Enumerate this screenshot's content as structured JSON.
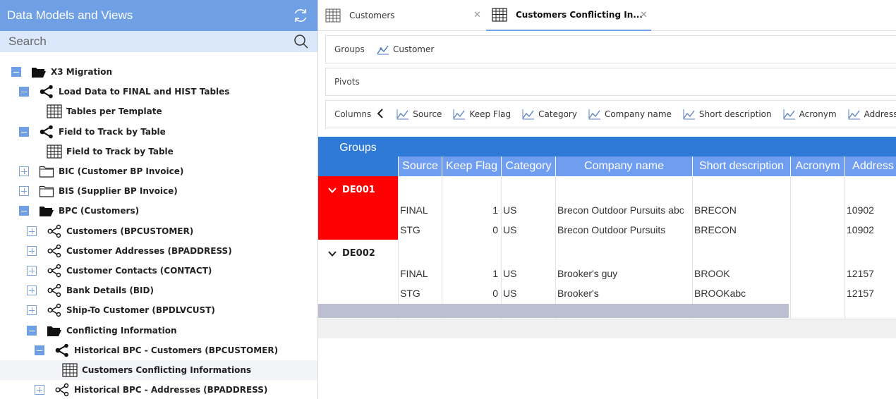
{
  "left_panel": {
    "title": "Data Models and Views",
    "search_placeholder": "Search",
    "tree": [
      {
        "label": "X3 Migration",
        "level": 0,
        "expander": "minus",
        "icon": "folder-open-icon"
      },
      {
        "label": "Load Data to FINAL and HIST Tables",
        "level": 1,
        "expander": "minus",
        "icon": "model-graph-icon"
      },
      {
        "label": "Tables per Template",
        "level": 2,
        "expander": "none",
        "icon": "table-grid-icon"
      },
      {
        "label": "Field to Track by Table",
        "level": 1,
        "expander": "minus",
        "icon": "model-graph-icon"
      },
      {
        "label": "Field to Track by Table",
        "level": 2,
        "expander": "none",
        "icon": "table-grid-icon"
      },
      {
        "label": "BIC (Customer BP Invoice)",
        "level": 1,
        "expander": "plus",
        "icon": "folder-closed-icon"
      },
      {
        "label": "BIS (Supplier BP Invoice)",
        "level": 1,
        "expander": "plus",
        "icon": "folder-closed-icon"
      },
      {
        "label": "BPC (Customers)",
        "level": 1,
        "expander": "minus",
        "icon": "folder-open-icon"
      },
      {
        "label": "Customers (BPCUSTOMER)",
        "level": 2,
        "expander": "plus",
        "icon": "model-graph-outline-icon"
      },
      {
        "label": "Customer Addresses (BPADDRESS)",
        "level": 2,
        "expander": "plus",
        "icon": "model-graph-outline-icon"
      },
      {
        "label": "Customer Contacts (CONTACT)",
        "level": 2,
        "expander": "plus",
        "icon": "model-graph-outline-icon"
      },
      {
        "label": "Bank Details (BID)",
        "level": 2,
        "expander": "plus",
        "icon": "model-graph-outline-icon"
      },
      {
        "label": "Ship-To Customer (BPDLVCUST)",
        "level": 2,
        "expander": "plus",
        "icon": "model-graph-outline-icon"
      },
      {
        "label": "Conflicting Information",
        "level": 2,
        "expander": "minus",
        "icon": "folder-open-icon"
      },
      {
        "label": "Historical BPC - Customers (BPCUSTOMER)",
        "level": 3,
        "expander": "minus",
        "icon": "model-graph-icon"
      },
      {
        "label": "Customers Conflicting Informations",
        "level": 4,
        "expander": "none",
        "icon": "table-grid-icon",
        "selected": true
      },
      {
        "label": "Historical BPC - Addresses (BPADDRESS)",
        "level": 3,
        "expander": "plus",
        "icon": "model-graph-outline-icon"
      }
    ]
  },
  "tabs": [
    {
      "label": "Customers",
      "active": false
    },
    {
      "label": "Customers Conflicting In...",
      "active": true
    }
  ],
  "zones": {
    "groups_label": "Groups",
    "groups_chips": [
      "Customer"
    ],
    "pivots_label": "Pivots",
    "columns_label": "Columns",
    "columns_chips": [
      "Source",
      "Keep Flag",
      "Category",
      "Company name",
      "Short description",
      "Acronym",
      "Address"
    ]
  },
  "grid": {
    "groups_header": "Groups",
    "columns": [
      "Source",
      "Keep Flag",
      "Category",
      "Company name",
      "Short description",
      "Acronym",
      "Address"
    ],
    "groups": [
      {
        "name": "DE001",
        "highlight": "#ff0000",
        "rows": [
          {
            "source": "FINAL",
            "keep_flag": "1",
            "category": "US",
            "company": "Brecon Outdoor Pursuits abc",
            "short": "BRECON",
            "acronym": "",
            "address": "10902"
          },
          {
            "source": "STG",
            "keep_flag": "0",
            "category": "US",
            "company": "Brecon Outdoor Pursuits",
            "short": "BRECON",
            "acronym": "",
            "address": "10902"
          }
        ]
      },
      {
        "name": "DE002",
        "highlight": "",
        "rows": [
          {
            "source": "FINAL",
            "keep_flag": "1",
            "category": "US",
            "company": "Brooker's guy",
            "short": "BROOK",
            "acronym": "",
            "address": "12157"
          },
          {
            "source": "STG",
            "keep_flag": "0",
            "category": "US",
            "company": "Brooker's",
            "short": "BROOKabc",
            "acronym": "",
            "address": "12157"
          }
        ]
      }
    ]
  },
  "colors": {
    "header_blue": "#6fa0e6",
    "grid_blue": "#2f7ad6",
    "col_header_blue": "#6f9ef0",
    "group_highlight": "#ff0000"
  }
}
